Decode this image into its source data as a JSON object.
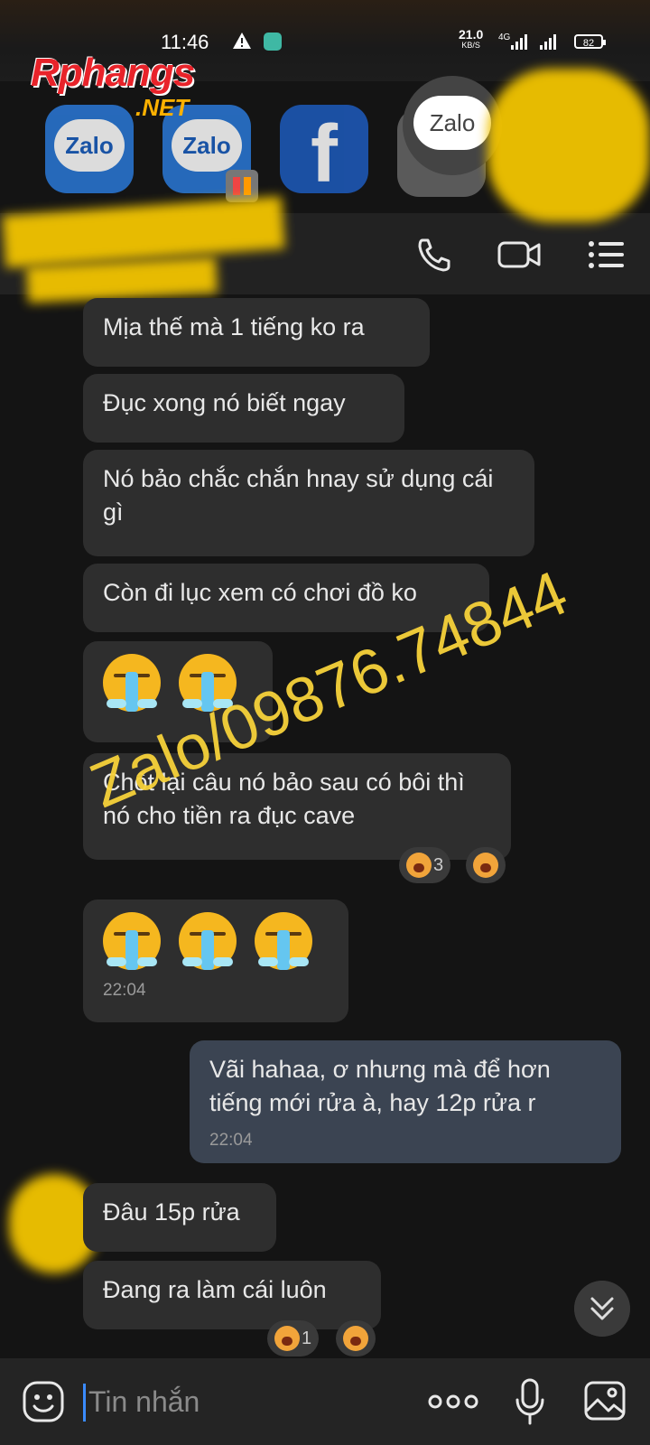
{
  "status_bar": {
    "time": "11:46",
    "net_speed": "21.0",
    "net_speed_unit": "KB/S",
    "network": "4G",
    "battery": "82"
  },
  "watermarks": {
    "site_logo": "Rphangs",
    "site_logo_suffix": ".NET",
    "overlay_text": "Zalo/09876.74844"
  },
  "bubble_apps": [
    {
      "name": "Zalo"
    },
    {
      "name": "Zalo"
    },
    {
      "name": "f"
    },
    {
      "name": "Zalo"
    }
  ],
  "header": {
    "icons": [
      "phone-icon",
      "video-call-icon",
      "menu-icon"
    ]
  },
  "messages": [
    {
      "dir": "in",
      "text": "Mịa thế mà 1 tiếng ko ra"
    },
    {
      "dir": "in",
      "text": "Đục xong nó biết ngay"
    },
    {
      "dir": "in",
      "text": "Nó bảo chắc chắn hnay sử dụng cái gì"
    },
    {
      "dir": "in",
      "text": "Còn đi lục xem có chơi đồ ko"
    },
    {
      "dir": "in",
      "type": "emoji"
    },
    {
      "dir": "in",
      "text": "Chốt lại câu nó bảo sau có bôi thì nó cho tiền ra đục cave",
      "reaction_count": "3"
    },
    {
      "dir": "in",
      "type": "emoji",
      "time": "22:04"
    },
    {
      "dir": "out",
      "text": "Vãi hahaa, ơ nhưng mà để hơn tiếng mới rửa à, hay 12p rửa r",
      "time": "22:04"
    },
    {
      "dir": "in",
      "text": "Đâu 15p rửa"
    },
    {
      "dir": "in",
      "text": "Đang ra làm cái luôn",
      "reaction_count": "1"
    }
  ],
  "composer": {
    "placeholder": "Tin nhắn"
  },
  "colors": {
    "background": "#141414",
    "incoming": "#2e2e2e",
    "outgoing": "#3b4452",
    "accent": "#3a8bff",
    "watermark": "#f7d23a"
  }
}
